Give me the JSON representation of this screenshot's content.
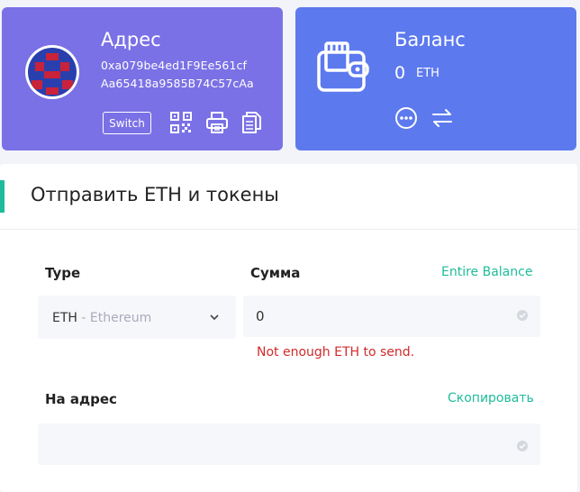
{
  "address_card": {
    "title": "Адрес",
    "address_line1": "0xa079be4ed1F9Ee561cf",
    "address_line2": "Aa65418a9585B74C57cAa",
    "switch_label": "Switch",
    "bg_color": "#7a71e6"
  },
  "balance_card": {
    "title": "Баланс",
    "value": "0",
    "unit": "ETH",
    "bg_color": "#5c79ee"
  },
  "send_panel": {
    "title": "Отправить ETH и токены",
    "accent_color": "#1fbc9b",
    "type_label": "Type",
    "type_value": "ETH",
    "type_sub": " - Ethereum",
    "amount_label": "Сумма",
    "entire_balance_link": "Entire Balance",
    "amount_value": "0",
    "error_text": "Not enough ETH to send.",
    "to_address_label": "На адрес",
    "copy_link": "Скопировать",
    "to_address_value": ""
  },
  "icons": [
    "qr-code-icon",
    "printer-icon",
    "copy-icon",
    "wallet-icon",
    "more-icon",
    "swap-icon",
    "chevron-down-icon",
    "check-circle-icon"
  ]
}
